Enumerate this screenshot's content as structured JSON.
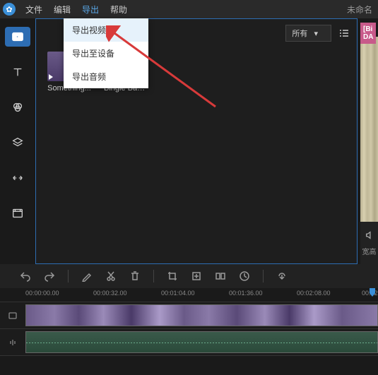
{
  "menubar": {
    "items": [
      "文件",
      "编辑",
      "导出",
      "帮助"
    ],
    "active_index": 2,
    "project_title": "未命名"
  },
  "export_dropdown": {
    "items": [
      "导出视频",
      "导出至设备",
      "导出音频"
    ],
    "highlighted_index": 0
  },
  "media_panel": {
    "filter_label": "所有",
    "clips": [
      {
        "name": "Something..."
      },
      {
        "name": "Bingle Ban..."
      }
    ]
  },
  "preview": {
    "badge_line1": "[Bi",
    "badge_line2": "DA",
    "ratio_label": "宽高"
  },
  "timeline": {
    "marks": [
      "00:00:00.00",
      "00:00:32.00",
      "00:01:04.00",
      "00:01:36.00",
      "00:02:08.00",
      "00:02"
    ]
  }
}
